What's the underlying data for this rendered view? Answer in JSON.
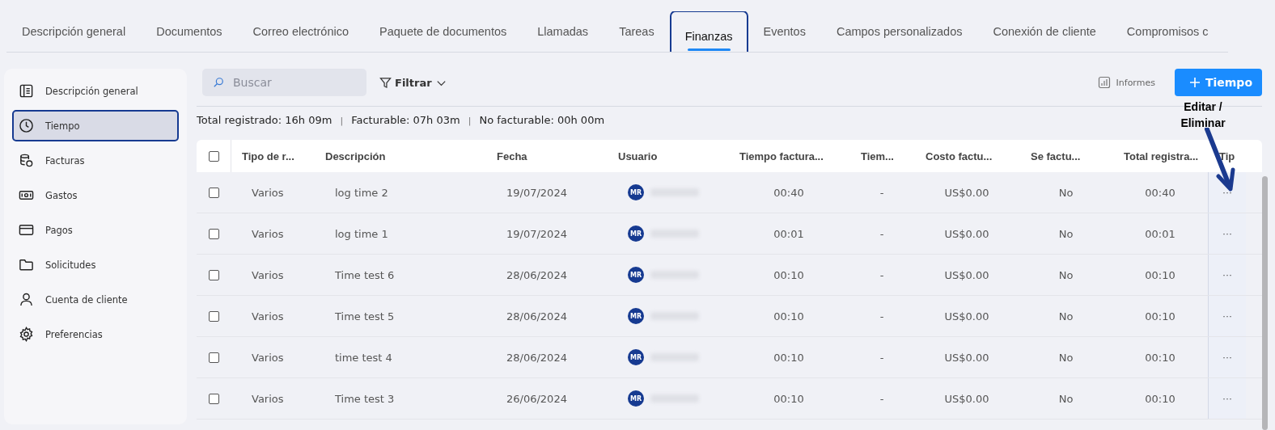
{
  "tabs": [
    {
      "label": "Descripción general",
      "selected": false,
      "highlighted": false
    },
    {
      "label": "Documentos",
      "selected": false,
      "highlighted": false
    },
    {
      "label": "Correo electrónico",
      "selected": false,
      "highlighted": false
    },
    {
      "label": "Paquete de documentos",
      "selected": false,
      "highlighted": false
    },
    {
      "label": "Llamadas",
      "selected": false,
      "highlighted": false
    },
    {
      "label": "Tareas",
      "selected": false,
      "highlighted": false
    },
    {
      "label": "Finanzas",
      "selected": true,
      "highlighted": true
    },
    {
      "label": "Eventos",
      "selected": false,
      "highlighted": false
    },
    {
      "label": "Campos personalizados",
      "selected": false,
      "highlighted": false
    },
    {
      "label": "Conexión de cliente",
      "selected": false,
      "highlighted": false
    },
    {
      "label": "Compromisos c",
      "selected": false,
      "highlighted": false
    }
  ],
  "sidebar": {
    "items": [
      {
        "label": "Descripción general",
        "selected": false,
        "highlighted": false
      },
      {
        "label": "Tiempo",
        "selected": true,
        "highlighted": true
      },
      {
        "label": "Facturas",
        "selected": false,
        "highlighted": false
      },
      {
        "label": "Gastos",
        "selected": false,
        "highlighted": false
      },
      {
        "label": "Pagos",
        "selected": false,
        "highlighted": false
      },
      {
        "label": "Solicitudes",
        "selected": false,
        "highlighted": false
      },
      {
        "label": "Cuenta de cliente",
        "selected": false,
        "highlighted": false
      },
      {
        "label": "Preferencias",
        "selected": false,
        "highlighted": false
      }
    ]
  },
  "toolbar": {
    "search": {
      "placeholder": "Buscar"
    },
    "filter": "Filtrar",
    "reports": "Informes",
    "add_button": "Tiempo"
  },
  "summary": [
    {
      "label": "Total registrado:",
      "value": "16h 09m"
    },
    {
      "label": "Facturable:",
      "value": "07h 03m"
    },
    {
      "label": "No facturable:",
      "value": "00h 00m"
    }
  ],
  "separator": "|",
  "table": {
    "all_checked": false,
    "columns": [
      "Tipo de r...",
      "Descripción",
      "Fecha",
      "Usuario",
      "Tiempo factura...",
      "Tiem...",
      "Costo factu...",
      "Se factu...",
      "Total registra...",
      "Tip"
    ],
    "rows": [
      {
        "checked": false,
        "cells": [
          "Varios",
          "log time 2",
          "19/07/2024",
          "MR",
          "00:40",
          "-",
          "US$0.00",
          "No",
          "00:40"
        ]
      },
      {
        "checked": false,
        "cells": [
          "Varios",
          "log time 1",
          "19/07/2024",
          "MR",
          "00:01",
          "-",
          "US$0.00",
          "No",
          "00:01"
        ]
      },
      {
        "checked": false,
        "cells": [
          "Varios",
          "Time test 6",
          "28/06/2024",
          "MR",
          "00:10",
          "-",
          "US$0.00",
          "No",
          "00:10"
        ]
      },
      {
        "checked": false,
        "cells": [
          "Varios",
          "Time test 5",
          "28/06/2024",
          "MR",
          "00:10",
          "-",
          "US$0.00",
          "No",
          "00:10"
        ]
      },
      {
        "checked": false,
        "cells": [
          "Varios",
          "time test 4",
          "28/06/2024",
          "MR",
          "00:10",
          "-",
          "US$0.00",
          "No",
          "00:10"
        ]
      },
      {
        "checked": false,
        "cells": [
          "Varios",
          "Time test 3",
          "26/06/2024",
          "MR",
          "00:10",
          "-",
          "US$0.00",
          "No",
          "00:10"
        ]
      }
    ],
    "row_menu": "···"
  },
  "annotation": {
    "text": "Editar / Eliminar"
  }
}
